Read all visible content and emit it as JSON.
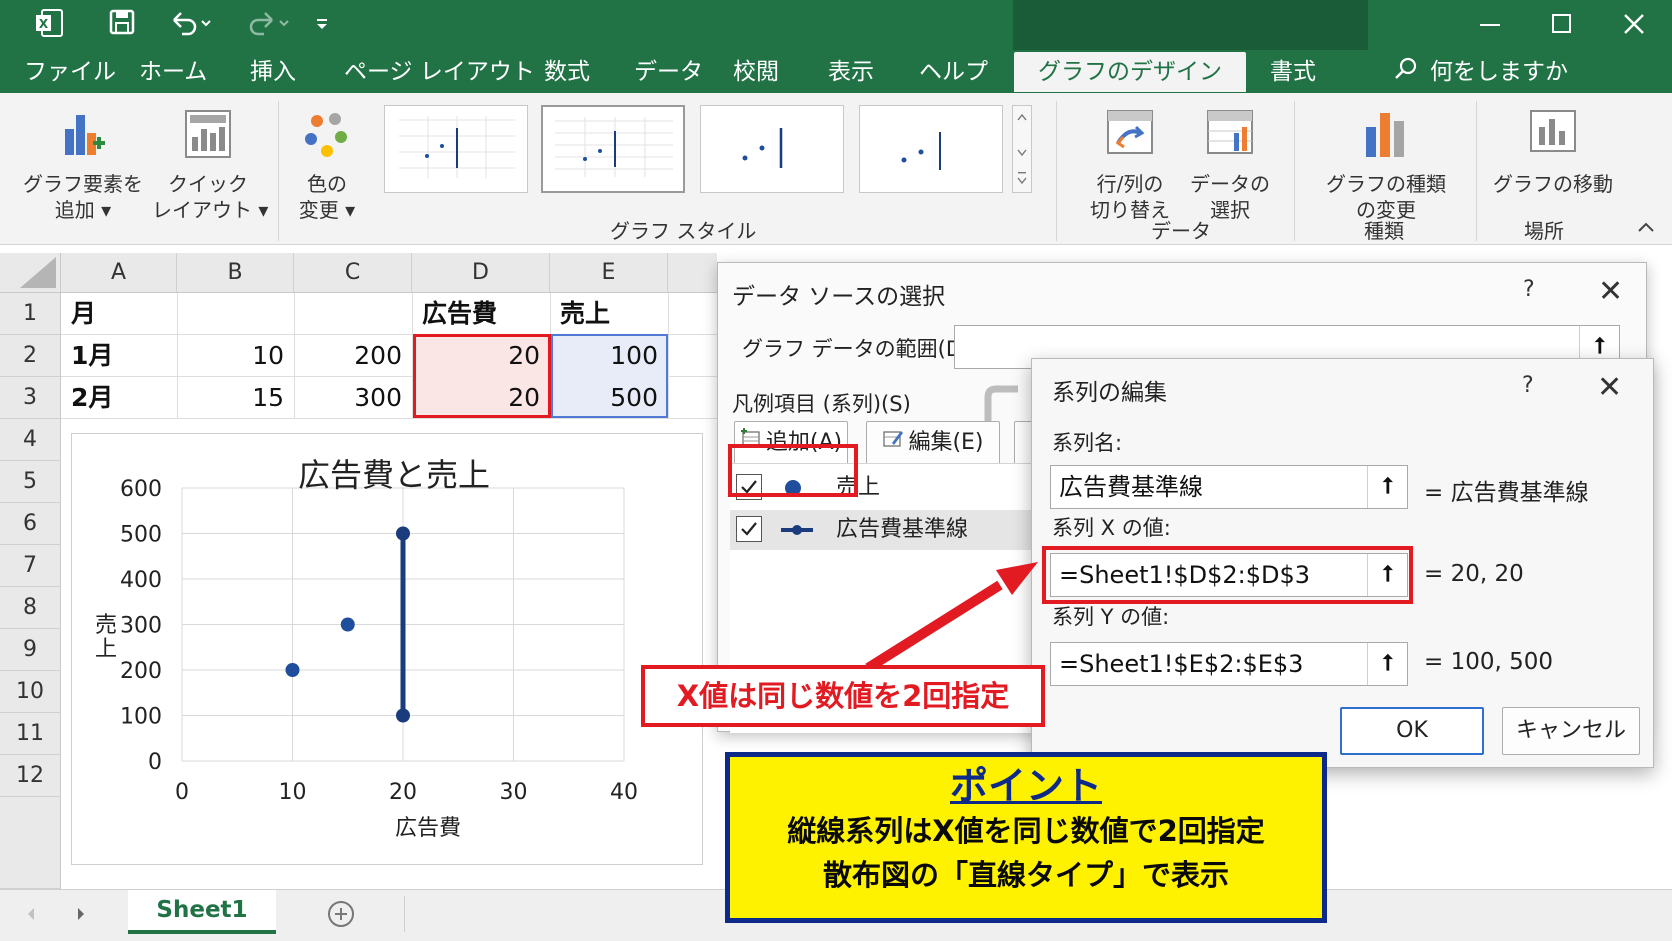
{
  "quick_access": {
    "excel_icon": "excel-icon",
    "save": "save-icon",
    "undo": "undo-icon",
    "redo": "redo-icon",
    "customize": "customize-icon"
  },
  "tabs": [
    "ファイル",
    "ホーム",
    "挿入",
    "ページ レイアウト",
    "数式",
    "データ",
    "校閲",
    "表示",
    "ヘルプ",
    "グラフのデザイン",
    "書式"
  ],
  "active_tab": "グラフのデザイン",
  "tell_me": "何をしますか",
  "ribbon": {
    "add_element": [
      "グラフ要素を",
      "追加 ▾"
    ],
    "quick_layout": [
      "クイック",
      "レイアウト ▾"
    ],
    "change_color": [
      "色の",
      "変更 ▾"
    ],
    "chart_styles_group": "グラフ スタイル",
    "switch_row_col": [
      "行/列の",
      "切り替え"
    ],
    "select_data": [
      "データの",
      "選択"
    ],
    "data_group": "データ",
    "change_type": [
      "グラフの種類",
      "の変更"
    ],
    "type_group": "種類",
    "move_chart": "グラフの移動",
    "location_group": "場所"
  },
  "columns": [
    "A",
    "B",
    "C",
    "D",
    "E"
  ],
  "rows": [
    "1",
    "2",
    "3",
    "4",
    "5",
    "6",
    "7",
    "8",
    "9",
    "10",
    "11",
    "12"
  ],
  "cells": {
    "r1": [
      "月",
      "",
      "",
      "広告費",
      "売上"
    ],
    "r2": [
      "1月",
      "10",
      "200",
      "20",
      "100"
    ],
    "r3": [
      "2月",
      "15",
      "300",
      "20",
      "500"
    ]
  },
  "chart_data": {
    "type": "scatter",
    "title": "広告費と売上",
    "xlabel": "広告費",
    "ylabel": "売上",
    "xlim": [
      0,
      40
    ],
    "ylim": [
      0,
      600
    ],
    "xticks": [
      "0",
      "10",
      "20",
      "30",
      "40"
    ],
    "yticks": [
      "0",
      "100",
      "200",
      "300",
      "400",
      "500",
      "600"
    ],
    "grid": true,
    "series": [
      {
        "name": "売上",
        "style": "markers",
        "color": "#1f4e9c",
        "x": [
          10,
          15
        ],
        "y": [
          200,
          300
        ]
      },
      {
        "name": "広告費基準線",
        "style": "line-markers",
        "color": "#1a3c7d",
        "x": [
          20,
          20
        ],
        "y": [
          100,
          500
        ]
      }
    ]
  },
  "sheet_tab": "Sheet1",
  "data_source_dialog": {
    "title": "データ ソースの選択",
    "help": "?",
    "close": "✕",
    "range_label": "グラフ データの範囲(D):",
    "legend_label": "凡例項目 (系列)(S)",
    "add_button": "追加(A)",
    "edit_button": "編集(E)",
    "series": [
      "売上",
      "広告費基準線"
    ]
  },
  "series_edit_dialog": {
    "title": "系列の編集",
    "help": "?",
    "close": "✕",
    "name_label": "系列名:",
    "name_value": "広告費基準線",
    "name_result": "= 広告費基準線",
    "x_label": "系列 X の値:",
    "x_value": "=Sheet1!$D$2:$D$3",
    "x_result": "= 20, 20",
    "y_label": "系列 Y の値:",
    "y_value": "=Sheet1!$E$2:$E$3",
    "y_result": "= 100, 500",
    "ok": "OK",
    "cancel": "キャンセル"
  },
  "callouts": {
    "red": "X値は同じ数値を2回指定",
    "point_title": "ポイント",
    "point_line1": "縦線系列はX値を同じ数値で2回指定",
    "point_line2": "散布図の「直線タイプ」で表示"
  },
  "colors": {
    "excel_green": "#217346",
    "accent_red": "#e21b23",
    "callout_yellow": "#fff200",
    "callout_navy": "#0d2a8a"
  }
}
